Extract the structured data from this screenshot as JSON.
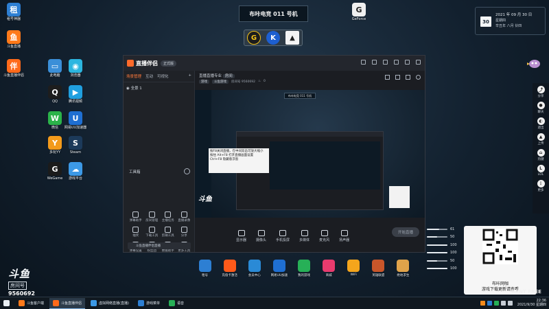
{
  "desktop_icons": [
    {
      "name": "icon-zu",
      "label": "租号神器",
      "glyph": "租",
      "color": "#2d7fd3"
    },
    {
      "name": "icon-douyu",
      "label": "斗鱼直播",
      "glyph": "鱼",
      "color": "#ff7a1a"
    },
    {
      "name": "icon-douyu-companion",
      "label": "斗鱼直播伴侣",
      "glyph": "伴",
      "color": "#ff6a1a"
    },
    {
      "name": "icon-this-pc",
      "label": "此电脑",
      "glyph": "▭",
      "color": "#3b8fd8"
    },
    {
      "name": "icon-browser",
      "label": "浏览器",
      "glyph": "◉",
      "color": "#2cb6e0"
    },
    {
      "name": "icon-qq",
      "label": "QQ",
      "glyph": "Q",
      "color": "#1d1d1d"
    },
    {
      "name": "icon-tencent-video",
      "label": "腾讯视频",
      "glyph": "▶",
      "color": "#20a0e0"
    },
    {
      "name": "icon-wechat",
      "label": "微信",
      "glyph": "W",
      "color": "#2bb34a"
    },
    {
      "name": "icon-netease-game",
      "label": "网易UU加速器",
      "glyph": "U",
      "color": "#1f6fd2"
    },
    {
      "name": "icon-duowan",
      "label": "多玩YY",
      "glyph": "Y",
      "color": "#f39a1b"
    },
    {
      "name": "icon-steam",
      "label": "Steam",
      "glyph": "S",
      "color": "#1c3a5a"
    },
    {
      "name": "icon-wegame",
      "label": "WeGame",
      "glyph": "G",
      "color": "#1b1b1b"
    },
    {
      "name": "icon-game-platform",
      "label": "游戏平台",
      "glyph": "☁",
      "color": "#3c99e6"
    },
    {
      "name": "icon-geq",
      "label": "GeForce",
      "glyph": "G",
      "color": "#f0f0f0"
    }
  ],
  "banner": {
    "title": "布咔电竞 011 号机"
  },
  "badges": [
    "G",
    "K",
    "▲"
  ],
  "calendar": {
    "day": "30",
    "line1": "2021 年 09 月 30 日",
    "line2": "星期四",
    "line3": "辛丑年 八月 廿四"
  },
  "right_sidebar": [
    {
      "name": "sidebar-share",
      "label": "分享",
      "glyph": "⤴"
    },
    {
      "name": "sidebar-chat",
      "label": "聊天",
      "glyph": "●"
    },
    {
      "name": "sidebar-exit",
      "label": "退出",
      "glyph": "◐"
    },
    {
      "name": "sidebar-upload",
      "label": "上传",
      "glyph": "▲"
    },
    {
      "name": "sidebar-hotkey",
      "label": "热键",
      "glyph": "⌂"
    },
    {
      "name": "sidebar-lol",
      "label": "LOL",
      "glyph": "L"
    },
    {
      "name": "sidebar-more",
      "label": "更多",
      "glyph": "⋮"
    }
  ],
  "app": {
    "title": "直播伴侣",
    "version": "正式版",
    "tabs": [
      "场景管理",
      "互动",
      "可视化"
    ],
    "scene_item": "全景 1",
    "tools_title": "工具箱",
    "tools": [
      {
        "label": "弹幕助手"
      },
      {
        "label": "房间管理"
      },
      {
        "label": "主播任务"
      },
      {
        "label": "直播录像"
      },
      {
        "label": "抽奖"
      },
      {
        "label": "下载工具"
      },
      {
        "label": "剪辑工具"
      },
      {
        "label": "分享"
      },
      {
        "label": "弹幕设置"
      },
      {
        "label": "粉丝团"
      },
      {
        "label": "数据助手"
      },
      {
        "label": "更多工具"
      }
    ],
    "notice": "斗鱼直播伴侣直播",
    "room_title": "直播直播专业",
    "room_status": "房间",
    "room_tag1": "游戏",
    "room_tag2": "斗鱼游戏",
    "room_id": "房间号 9560692",
    "room_fans": "0",
    "preview_tip_line1": "按F8关闭直播，在中间双击可放大缩小",
    "preview_tip_line2": "按住 Alt+F8 打开直播画面设置",
    "preview_tip_line3": "Ctrl+F8 隐藏悬浮窗",
    "controls": [
      {
        "name": "control-screen",
        "label": "显示器"
      },
      {
        "name": "control-camera",
        "label": "摄像头"
      },
      {
        "name": "control-phone",
        "label": "手机投屏"
      },
      {
        "name": "control-media",
        "label": "多媒体"
      },
      {
        "name": "control-mic",
        "label": "麦克风"
      },
      {
        "name": "control-speaker",
        "label": "扬声器"
      }
    ],
    "start_button": "开始直播"
  },
  "sliders": [
    {
      "name": "slider-1",
      "value": "61",
      "pct": 0.6
    },
    {
      "name": "slider-2",
      "value": "50",
      "pct": 0.5
    },
    {
      "name": "slider-3",
      "value": "100",
      "pct": 1.0
    },
    {
      "name": "slider-4",
      "value": "100",
      "pct": 1.0
    },
    {
      "name": "slider-5",
      "value": "50",
      "pct": 0.5
    },
    {
      "name": "slider-6",
      "value": "100",
      "pct": 1.0
    }
  ],
  "qr": {
    "caption1": "布咔网咖",
    "caption2": "游戏下载更新请查看"
  },
  "dbnt": "DBNT FREE",
  "dock": [
    {
      "name": "dock-zu",
      "label": "租号",
      "color": "#2d7fd3"
    },
    {
      "name": "dock-voucher",
      "label": "充值卡激活",
      "color": "#ff5a1a"
    },
    {
      "name": "dock-computer",
      "label": "会员中心",
      "color": "#2a8ad6"
    },
    {
      "name": "dock-netease",
      "label": "网易UU加速",
      "color": "#1f6fd2"
    },
    {
      "name": "dock-game",
      "label": "我的游戏",
      "color": "#27b057"
    },
    {
      "name": "dock-shop",
      "label": "商城",
      "color": "#e83b6e"
    },
    {
      "name": "dock-wifi",
      "label": "WiFi",
      "color": "#f4a51c"
    },
    {
      "name": "dock-lol",
      "label": "英雄联盟",
      "color": "#c8562a"
    },
    {
      "name": "dock-pubg",
      "label": "绝地求生",
      "color": "#e0a34a"
    }
  ],
  "douyu": {
    "brand": "斗鱼",
    "room_label": "房间号",
    "room_number": "9560692"
  },
  "taskbar": [
    {
      "name": "taskbar-item-1",
      "label": "斗鱼客户端",
      "color": "#ff7a1a"
    },
    {
      "name": "taskbar-item-2",
      "label": "斗鱼直播伴侣",
      "color": "#ff6a1a",
      "active": true
    },
    {
      "name": "taskbar-item-3",
      "label": "虚拟网络直播(直播)",
      "color": "#3c99e6"
    },
    {
      "name": "taskbar-item-4",
      "label": "游戏菜单",
      "color": "#2d7fd3"
    },
    {
      "name": "taskbar-item-5",
      "label": "语音",
      "color": "#27b057"
    }
  ],
  "clock": {
    "time": "22:36",
    "date": "2021/9/30 星期四"
  }
}
